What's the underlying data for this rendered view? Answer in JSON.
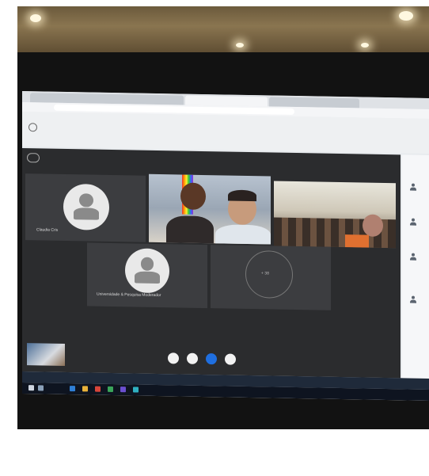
{
  "scene": {
    "description_kind": "photo of a laptop screen showing a video call"
  },
  "browser": {
    "tabs": [
      "",
      "",
      ""
    ],
    "url": ""
  },
  "notice": {
    "text": ""
  },
  "call": {
    "participants": [
      {
        "name": "Claudia Cris"
      },
      {
        "name": "Universidade & Pesquisa Moderador"
      },
      {
        "name": ""
      }
    ],
    "overflow_label": "+ 38"
  },
  "colors": {
    "call_background": "#2b2c2e",
    "accent_blue": "#1f6fe0",
    "taskbar": "#1f2a3a"
  }
}
